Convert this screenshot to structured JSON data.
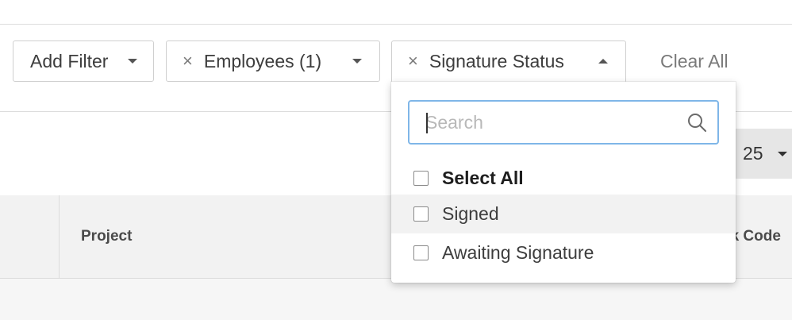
{
  "filters": {
    "add_filter_label": "Add Filter",
    "employees_label": "Employees (1)",
    "signature_status_label": "Signature Status",
    "remove_glyph": "×",
    "clear_all_label": "Clear All"
  },
  "pagination": {
    "page_size_value": "25"
  },
  "table": {
    "columns": [
      "Project",
      "sk Code"
    ]
  },
  "dropdown": {
    "search_placeholder": "Search",
    "search_value": "",
    "options": [
      {
        "label": "Select All",
        "checked": false
      },
      {
        "label": "Signed",
        "checked": false
      },
      {
        "label": "Awaiting Signature",
        "checked": false
      }
    ]
  },
  "colors": {
    "focus_border": "#7fb6e8",
    "header_bg": "#f2f2f2",
    "hover_row": "#f2f2f2"
  }
}
